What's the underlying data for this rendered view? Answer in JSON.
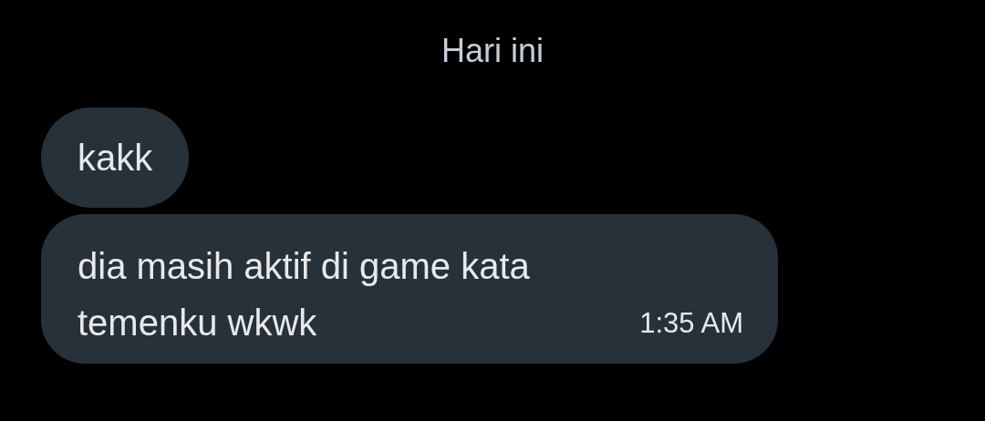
{
  "date_separator": "Hari ini",
  "messages": [
    {
      "text": "kakk"
    },
    {
      "text": "dia masih aktif di game kata temenku wkwk",
      "time": "1:35 AM"
    }
  ]
}
